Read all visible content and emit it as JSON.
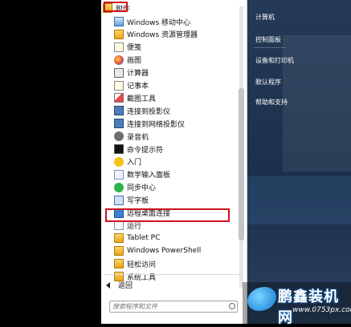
{
  "start_menu": {
    "programs": {
      "folder_title": "附件",
      "items": [
        {
          "label": "Windows 移动中心",
          "icon": "mobility-center-icon"
        },
        {
          "label": "Windows 资源管理器",
          "icon": "explorer-icon"
        },
        {
          "label": "便笺",
          "icon": "sticky-notes-icon"
        },
        {
          "label": "画图",
          "icon": "paint-icon"
        },
        {
          "label": "计算器",
          "icon": "calculator-icon"
        },
        {
          "label": "记事本",
          "icon": "notepad-icon"
        },
        {
          "label": "截图工具",
          "icon": "snipping-tool-icon"
        },
        {
          "label": "连接到投影仪",
          "icon": "projector-icon"
        },
        {
          "label": "连接到网络投影仪",
          "icon": "network-projector-icon"
        },
        {
          "label": "录音机",
          "icon": "microphone-icon"
        },
        {
          "label": "命令提示符",
          "icon": "command-prompt-icon"
        },
        {
          "label": "入门",
          "icon": "star-icon"
        },
        {
          "label": "数学输入面板",
          "icon": "math-input-icon"
        },
        {
          "label": "同步中心",
          "icon": "sync-icon"
        },
        {
          "label": "写字板",
          "icon": "wordpad-icon"
        },
        {
          "label": "远程桌面连接",
          "icon": "remote-desktop-icon"
        },
        {
          "label": "运行",
          "icon": "run-icon"
        },
        {
          "label": "Tablet PC",
          "icon": "folder-icon"
        },
        {
          "label": "Windows PowerShell",
          "icon": "folder-icon"
        },
        {
          "label": "轻松访问",
          "icon": "folder-icon"
        },
        {
          "label": "系统工具",
          "icon": "folder-icon"
        }
      ]
    },
    "back_label": "返回",
    "search": {
      "placeholder": "搜索程序和文件"
    },
    "right_pane": [
      "计算机",
      "控制面板",
      "设备和打印机",
      "默认程序",
      "帮助和支持"
    ]
  },
  "watermark": {
    "brand": "鹏鑫装机网",
    "url": "www.0753px.com"
  }
}
